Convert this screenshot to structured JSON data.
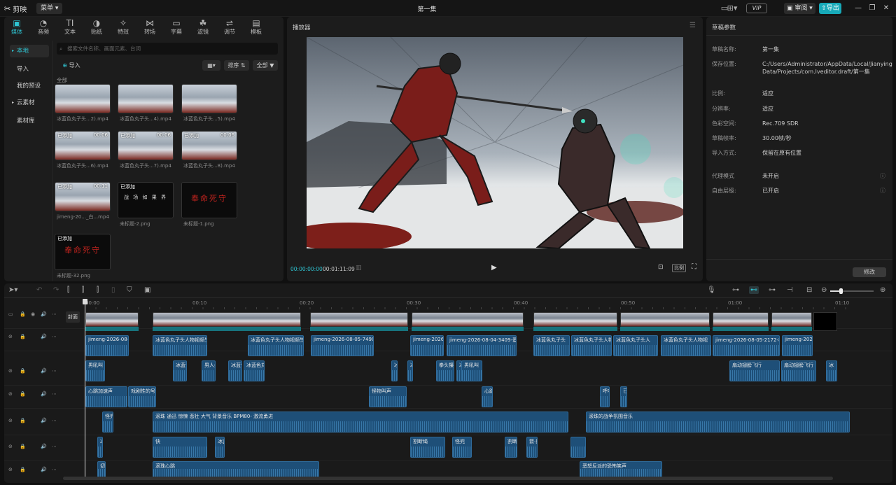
{
  "topbar": {
    "app_name": "剪映",
    "menu_label": "菜单",
    "project_title": "第一集",
    "vip_label": "VIP",
    "review_label": "审阅",
    "export_label": "导出",
    "icons": [
      "layout-icon",
      "monitor-icon",
      "minimize-icon",
      "maximize-icon",
      "close-icon"
    ]
  },
  "media_panel": {
    "tabs": [
      {
        "label": "媒体",
        "icon": "media-icon",
        "active": true
      },
      {
        "label": "音频",
        "icon": "audio-icon"
      },
      {
        "label": "文本",
        "icon": "text-icon"
      },
      {
        "label": "贴纸",
        "icon": "sticker-icon"
      },
      {
        "label": "特效",
        "icon": "effects-icon"
      },
      {
        "label": "转场",
        "icon": "transition-icon"
      },
      {
        "label": "字幕",
        "icon": "subtitle-icon"
      },
      {
        "label": "滤镜",
        "icon": "filter-icon"
      },
      {
        "label": "调节",
        "icon": "adjust-icon"
      },
      {
        "label": "模板",
        "icon": "template-icon"
      }
    ],
    "sidebar": [
      {
        "label": "本地",
        "active": true
      },
      {
        "label": "导入"
      },
      {
        "label": "我的预设"
      },
      {
        "label": "云素材"
      },
      {
        "label": "素材库"
      }
    ],
    "search_placeholder": "搜索文件名称、画面元素、台词",
    "import_label": "导入",
    "sort_label": "排序",
    "filter_label": "全部",
    "section_label": "全部",
    "items": [
      {
        "name": "冰蓝色丸子头...2).mp4",
        "badge": "",
        "duration": "",
        "kind": "video"
      },
      {
        "name": "冰蓝色丸子头...4).mp4",
        "badge": "",
        "duration": "",
        "kind": "video"
      },
      {
        "name": "冰蓝色丸子头...5).mp4",
        "badge": "",
        "duration": "",
        "kind": "video"
      },
      {
        "name": "冰蓝色丸子头...6).mp4",
        "badge": "已添加",
        "duration": "00:06",
        "kind": "video"
      },
      {
        "name": "冰蓝色丸子头...7).mp4",
        "badge": "已添加",
        "duration": "00:06",
        "kind": "video"
      },
      {
        "name": "冰蓝色丸子头...8).mp4",
        "badge": "已添加",
        "duration": "00:06",
        "kind": "video"
      },
      {
        "name": "jimeng-20..._白...mp4",
        "badge": "已添加",
        "duration": "00:11",
        "kind": "video"
      },
      {
        "name": "未标题-2.png",
        "badge": "已添加",
        "duration": "",
        "kind": "text",
        "text": "战 场 如 果 界"
      },
      {
        "name": "未标题-1.png",
        "badge": "",
        "duration": "",
        "kind": "text",
        "text": "奉命死守"
      },
      {
        "name": "未标题-32.png",
        "badge": "已添加",
        "duration": "",
        "kind": "text",
        "text": "奉命死守"
      }
    ]
  },
  "player": {
    "title": "播放器",
    "current_time": "00:00:00:00",
    "total_time": "00:01:11:09",
    "ratio_label": "比例"
  },
  "params": {
    "title": "草稿参数",
    "rows": [
      {
        "key": "草稿名称:",
        "value": "第一集"
      },
      {
        "key": "保存位置:",
        "value": "C:/Users/Administrator/AppData/Local/JianyingPro/User Data/Projects/com.lveditor.draft/第一集"
      },
      {
        "key": "比例:",
        "value": "适应"
      },
      {
        "key": "分辨率:",
        "value": "适应"
      },
      {
        "key": "色彩空间:",
        "value": "Rec.709 SDR"
      },
      {
        "key": "草稿帧率:",
        "value": "30.00帧/秒"
      },
      {
        "key": "导入方式:",
        "value": "保留在原有位置"
      },
      {
        "key": "代理模式",
        "value": "未开启"
      },
      {
        "key": "自由层级:",
        "value": "已开启"
      }
    ],
    "edit_label": "修改"
  },
  "timeline": {
    "cover_label": "封面",
    "ticks": [
      "00:00",
      "00:10",
      "00:20",
      "00:30",
      "00:40",
      "00:50",
      "01:00",
      "01:10"
    ],
    "audio_tracks": [
      [
        {
          "label": "jimeng-2026-08-0"
        },
        {
          "label": "冰蓝色丸子头人物视频生"
        },
        {
          "label": "冰蓝色丸子头人物视频生"
        },
        {
          "label": "jimeng-2026-08-05-7490-9"
        },
        {
          "label": "jimeng-2026-08-04-1"
        },
        {
          "label": "jimeng-2026-08-04-3409-蛋"
        },
        {
          "label": "冰蓝色丸子头"
        },
        {
          "label": "冰蓝色丸子头人物视"
        },
        {
          "label": "冰蓝色丸子头人"
        },
        {
          "label": "冰蓝色丸子头人物视"
        },
        {
          "label": "jimeng-2026-08-05-2172-模"
        },
        {
          "label": "jimeng-2026"
        }
      ],
      [
        {
          "label": "男吼叫"
        },
        {
          "label": "冰蓝色"
        },
        {
          "label": "男人尖"
        },
        {
          "label": "冰蓝色"
        },
        {
          "label": "冰蓝色丸子"
        },
        {
          "label": "冰"
        },
        {
          "label": "冰"
        },
        {
          "label": "拳头攥紧"
        },
        {
          "label": "冰"
        },
        {
          "label": "男吼叫"
        },
        {
          "label": "扇动翅膀飞行"
        },
        {
          "label": "扇动翅膀飞行"
        },
        {
          "label": "冰"
        }
      ],
      [
        {
          "label": "心跳加速声"
        },
        {
          "label": "戏剧性的号"
        },
        {
          "label": "怪物叫声"
        },
        {
          "label": "心跳"
        },
        {
          "label": "呼吸"
        },
        {
          "label": "已"
        }
      ],
      [
        {
          "label": "怪兜"
        },
        {
          "label": "滚珠 通迅 惊悚 悲壮 大气 背景音乐 BPM80- 激流勇进"
        },
        {
          "label": "滚珠的战争氛围音乐"
        }
      ],
      [
        {
          "label": "冰蓝色丸子头人"
        },
        {
          "label": "快"
        },
        {
          "label": "冰蓝色丸子头人"
        },
        {
          "label": "割断绳"
        },
        {
          "label": "怪兜"
        },
        {
          "label": "割断"
        },
        {
          "label": "箭·翼射"
        }
      ],
      [
        {
          "label": "切"
        },
        {
          "label": "滚珠心跳"
        },
        {
          "label": "恶怒反派的恐怖笑声"
        }
      ]
    ]
  }
}
